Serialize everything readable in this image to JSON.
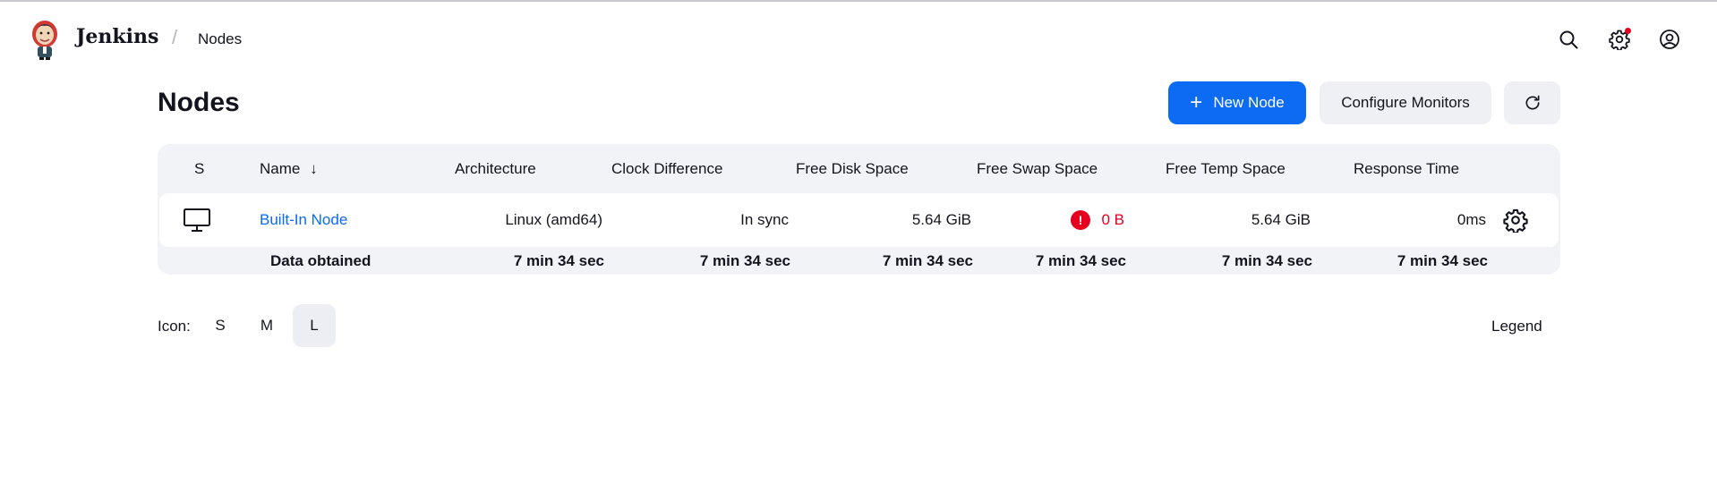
{
  "header": {
    "brand": "Jenkins",
    "breadcrumb_sep": "/",
    "breadcrumb": "Nodes",
    "icons": [
      "search-icon",
      "gear-icon",
      "user-icon"
    ],
    "notification_color": "#e6001f"
  },
  "page": {
    "title": "Nodes",
    "new_node_label": "New Node",
    "configure_monitors_label": "Configure Monitors"
  },
  "table": {
    "columns": [
      "S",
      "Name",
      "Architecture",
      "Clock Difference",
      "Free Disk Space",
      "Free Swap Space",
      "Free Temp Space",
      "Response Time"
    ],
    "sort_indicator": "↓",
    "rows": [
      {
        "name": "Built-In Node",
        "architecture": "Linux (amd64)",
        "clock_difference": "In sync",
        "free_disk_space": "5.64 GiB",
        "free_swap_space": "0 B",
        "free_temp_space": "5.64 GiB",
        "response_time": "0ms"
      }
    ],
    "footer": {
      "label": "Data obtained",
      "architecture": "7 min 34 sec",
      "clock_difference": "7 min 34 sec",
      "free_disk_space": "7 min 34 sec",
      "free_swap_space": "7 min 34 sec",
      "free_temp_space": "7 min 34 sec",
      "response_time": "7 min 34 sec"
    }
  },
  "bottom": {
    "icon_label": "Icon:",
    "sizes": [
      "S",
      "M",
      "L"
    ],
    "active_size": "L",
    "legend": "Legend"
  },
  "colors": {
    "accent": "#0b6bf2",
    "warning": "#e6001f",
    "panel": "#f1f3f6"
  }
}
